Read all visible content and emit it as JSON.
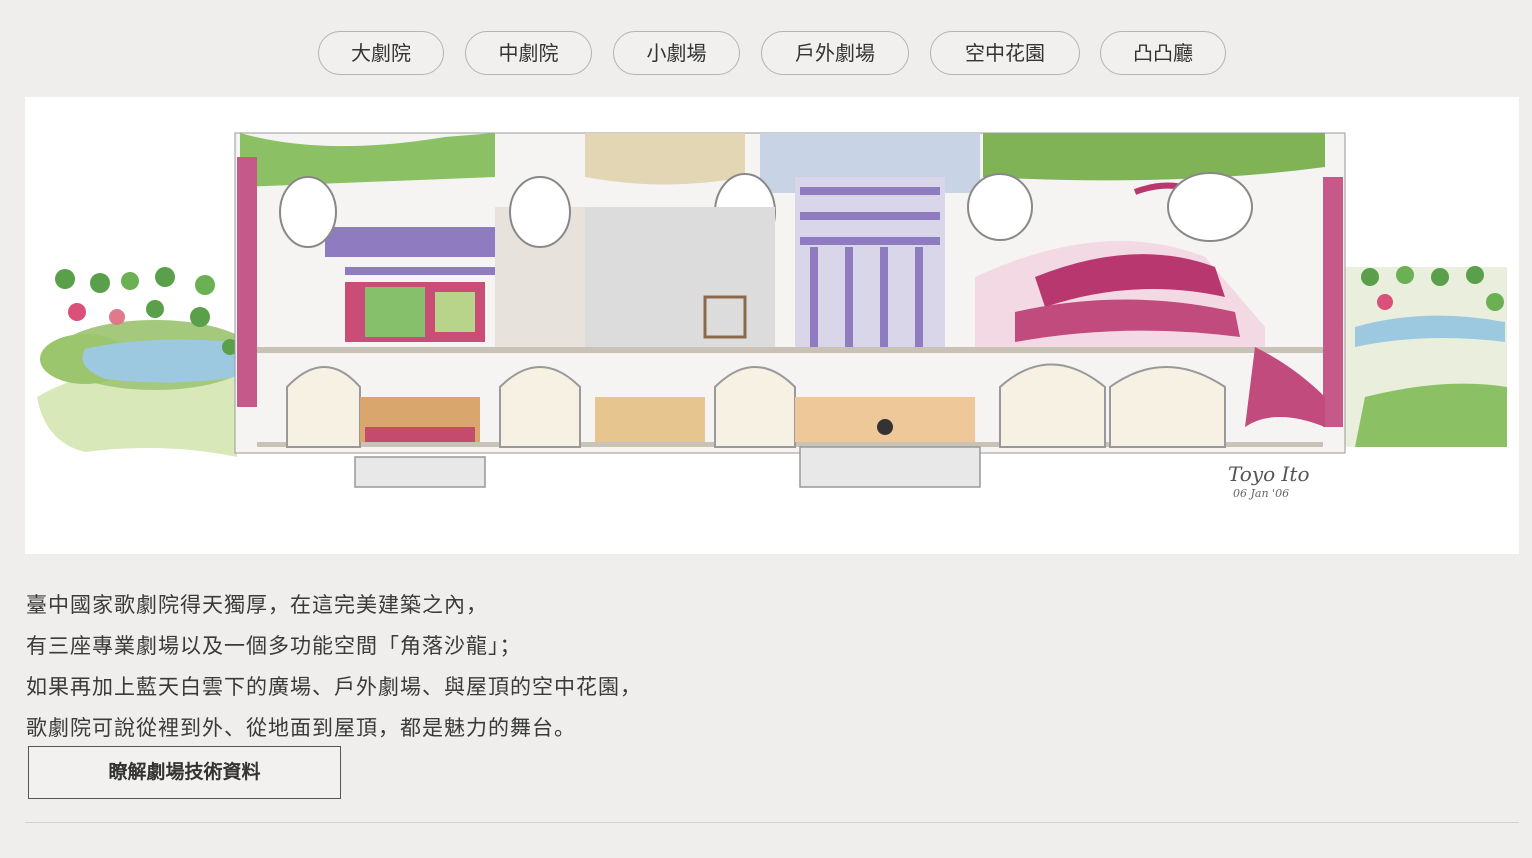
{
  "tabs": [
    {
      "label": "大劇院"
    },
    {
      "label": "中劇院"
    },
    {
      "label": "小劇場"
    },
    {
      "label": "戶外劇場"
    },
    {
      "label": "空中花園"
    },
    {
      "label": "凸凸廳"
    }
  ],
  "illustration": {
    "signature_name": "Toyo Ito",
    "signature_date": "06 Jan '06"
  },
  "description": {
    "lines": [
      "臺中國家歌劇院得天獨厚，在這完美建築之內，",
      "有三座專業劇場以及一個多功能空間「角落沙龍」；",
      "如果再加上藍天白雲下的廣場、戶外劇場、與屋頂的空中花園，",
      "歌劇院可說從裡到外、從地面到屋頂，都是魅力的舞台。"
    ]
  },
  "cta": {
    "label": "瞭解劇場技術資料"
  },
  "colors": {
    "background": "#efeeec",
    "accent_magenta": "#b8376e",
    "accent_purple": "#7b64b0",
    "garden_green": "#7fb356"
  }
}
